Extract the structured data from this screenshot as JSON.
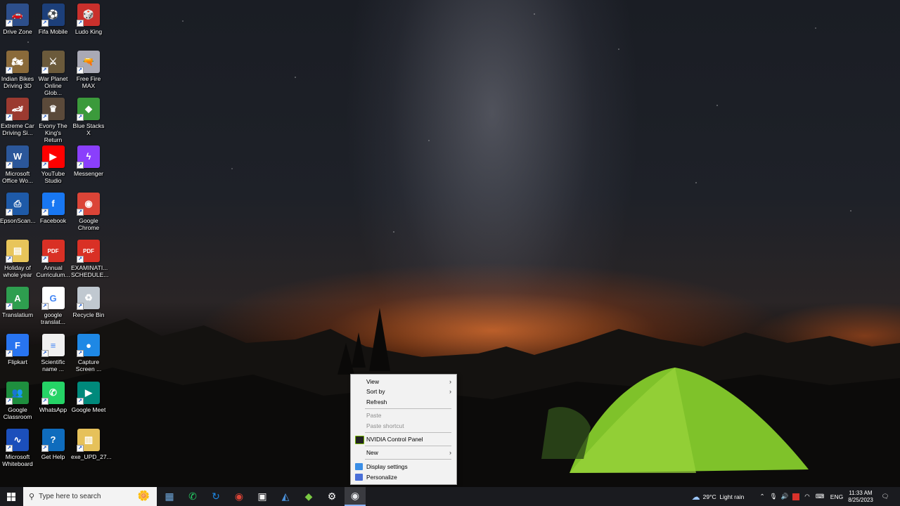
{
  "desktop_icons": [
    {
      "label": "Drive Zone",
      "icon": "car-game-icon",
      "color": "#2d4f8b",
      "glyph": "🚗"
    },
    {
      "label": "Fifa Mobile",
      "icon": "fifa-icon",
      "color": "#1c3f7a",
      "glyph": "⚽"
    },
    {
      "label": "Ludo King",
      "icon": "ludo-icon",
      "color": "#c9302c",
      "glyph": "🎲"
    },
    {
      "label": "Indian Bikes\nDriving 3D",
      "icon": "bike-game-icon",
      "color": "#8a6a3a",
      "glyph": "🏍"
    },
    {
      "label": "War Planet\nOnline Glob...",
      "icon": "war-planet-icon",
      "color": "#6b5a3b",
      "glyph": "⚔"
    },
    {
      "label": "Free Fire\nMAX",
      "icon": "free-fire-icon",
      "color": "#a9a9b5",
      "glyph": "🔫"
    },
    {
      "label": "Extreme Car\nDriving Si...",
      "icon": "extreme-car-icon",
      "color": "#9b3a30",
      "glyph": "🏎"
    },
    {
      "label": "Evony The\nKing's Return",
      "icon": "evony-icon",
      "color": "#5b4a3a",
      "glyph": "♛"
    },
    {
      "label": "Blue Stacks X",
      "icon": "bluestacks-icon",
      "color": "#3b9a3b",
      "glyph": "◆"
    },
    {
      "label": "Microsoft\nOffice Wo...",
      "icon": "word-icon",
      "color": "#2b579a",
      "glyph": "W"
    },
    {
      "label": "YouTube\nStudio",
      "icon": "youtube-studio-icon",
      "color": "#ff0000",
      "glyph": "▶"
    },
    {
      "label": "Messenger",
      "icon": "messenger-icon",
      "color": "#8a3ffc",
      "glyph": "ϟ"
    },
    {
      "label": "EpsonScan...",
      "icon": "epson-scan-icon",
      "color": "#1e5aa8",
      "glyph": "⎙"
    },
    {
      "label": "Facebook",
      "icon": "facebook-icon",
      "color": "#1877f2",
      "glyph": "f"
    },
    {
      "label": "Google\nChrome",
      "icon": "chrome-icon",
      "color": "#db4437",
      "glyph": "◉"
    },
    {
      "label": "Holiday of\nwhole year",
      "icon": "folder-icon",
      "color": "#e8c55a",
      "glyph": "▤"
    },
    {
      "label": "Annual\nCurriculum...",
      "icon": "pdf-icon",
      "color": "#d93025",
      "glyph": "PDF"
    },
    {
      "label": "EXAMINATI...\nSCHEDULE...",
      "icon": "pdf-icon",
      "color": "#d93025",
      "glyph": "PDF"
    },
    {
      "label": "Translatium",
      "icon": "translatium-icon",
      "color": "#2e9e4f",
      "glyph": "A"
    },
    {
      "label": "google\ntranslat...",
      "icon": "google-icon",
      "color": "#ffffff",
      "glyph": "G"
    },
    {
      "label": "Recycle Bin",
      "icon": "recycle-bin-icon",
      "color": "#c0c8d0",
      "glyph": "♻"
    },
    {
      "label": "Flipkart",
      "icon": "flipkart-icon",
      "color": "#2874f0",
      "glyph": "F"
    },
    {
      "label": "Scientific\nname ...",
      "icon": "document-icon",
      "color": "#f0f0f0",
      "glyph": "≡"
    },
    {
      "label": "Capture\nScreen ...",
      "icon": "capture-screen-icon",
      "color": "#1e88e5",
      "glyph": "●"
    },
    {
      "label": "Google\nClassroom",
      "icon": "classroom-icon",
      "color": "#1e8e3e",
      "glyph": "👥"
    },
    {
      "label": "WhatsApp",
      "icon": "whatsapp-icon",
      "color": "#25d366",
      "glyph": "✆"
    },
    {
      "label": "Google Meet",
      "icon": "meet-icon",
      "color": "#00897b",
      "glyph": "▶"
    },
    {
      "label": "Microsoft\nWhiteboard",
      "icon": "whiteboard-icon",
      "color": "#1b4fbb",
      "glyph": "∿"
    },
    {
      "label": "Get Help",
      "icon": "get-help-icon",
      "color": "#0f6cbd",
      "glyph": "?"
    },
    {
      "label": "exe_UPD_27...",
      "icon": "zip-folder-icon",
      "color": "#e6c15a",
      "glyph": "▥"
    }
  ],
  "context_menu": {
    "items": [
      {
        "label": "View",
        "submenu": true,
        "enabled": true
      },
      {
        "label": "Sort by",
        "submenu": true,
        "enabled": true
      },
      {
        "label": "Refresh",
        "submenu": false,
        "enabled": true
      },
      {
        "label": "Paste",
        "submenu": false,
        "enabled": false
      },
      {
        "label": "Paste shortcut",
        "submenu": false,
        "enabled": false
      },
      {
        "label": "NVIDIA Control Panel",
        "submenu": false,
        "enabled": true,
        "icon": "nvidia-icon"
      },
      {
        "label": "New",
        "submenu": true,
        "enabled": true
      },
      {
        "label": "Display settings",
        "submenu": false,
        "enabled": true,
        "icon": "display-icon"
      },
      {
        "label": "Personalize",
        "submenu": false,
        "enabled": true,
        "icon": "personalize-icon"
      }
    ]
  },
  "taskbar": {
    "search_placeholder": "Type here to search",
    "pinned": [
      {
        "name": "taskbar-notepad-icon",
        "glyph": "▦",
        "color": "#6fa8dc"
      },
      {
        "name": "taskbar-whatsapp-icon",
        "glyph": "✆",
        "color": "#25d366"
      },
      {
        "name": "taskbar-sync-icon",
        "glyph": "↻",
        "color": "#1e88e5"
      },
      {
        "name": "taskbar-chrome-icon",
        "glyph": "◉",
        "color": "#db4437"
      },
      {
        "name": "taskbar-store-icon",
        "glyph": "▣",
        "color": "#f3f3f3"
      },
      {
        "name": "taskbar-scanner-icon",
        "glyph": "◭",
        "color": "#4a90d9"
      },
      {
        "name": "taskbar-bluestacks-icon",
        "glyph": "◆",
        "color": "#7ac943"
      },
      {
        "name": "taskbar-settings-icon",
        "glyph": "⚙",
        "color": "#ffffff"
      },
      {
        "name": "taskbar-chrome-profile-icon",
        "glyph": "◉",
        "color": "#e8eaed"
      }
    ],
    "weather": {
      "temp": "29°C",
      "condition": "Light rain"
    },
    "language": "ENG",
    "time": "11:33 AM",
    "date": "8/25/2023"
  }
}
